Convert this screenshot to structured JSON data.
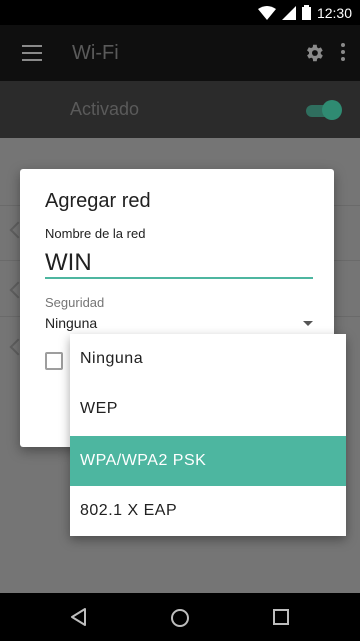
{
  "status_bar": {
    "time": "12:30"
  },
  "app_bar": {
    "title": "Wi-Fi"
  },
  "master_switch": {
    "label": "Activado"
  },
  "dialog": {
    "title": "Agregar red",
    "name_label": "Nombre de la red",
    "name_value": "WIN",
    "security_label": "Seguridad",
    "security_value": "Ninguna"
  },
  "security_menu": {
    "options": [
      "Ninguna",
      "WEP",
      "WPA/WPA2 PSK",
      "802.1 X EAP"
    ],
    "highlighted": "WPA/WPA2 PSK"
  },
  "colors": {
    "accent": "#4db6a0"
  }
}
